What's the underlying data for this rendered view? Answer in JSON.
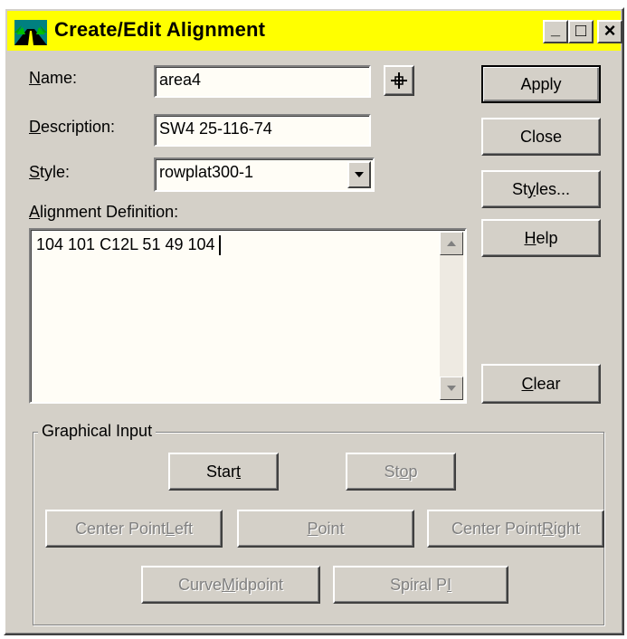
{
  "window": {
    "title": "Create/Edit Alignment",
    "title_bar_color": "#ffff00",
    "controls": {
      "minimize": "_",
      "maximize": "□",
      "close": "×"
    }
  },
  "form": {
    "name_label_key": "N",
    "name_label_rest": "ame:",
    "name_value": "area4",
    "description_label_key": "D",
    "description_label_rest": "escription:",
    "description_value": "SW4 25-116-74",
    "style_label_key": "S",
    "style_label_rest": "tyle:",
    "style_value": "rowplat300-1",
    "definition_label_key": "A",
    "definition_label_rest": "lignment Definition:",
    "definition_value": "104 101 C12L 51 49 104"
  },
  "buttons": {
    "apply": "Apply",
    "close": "Close",
    "styles_pre": "St",
    "styles_key": "y",
    "styles_post": "les...",
    "help_key": "H",
    "help_post": "elp",
    "clear_key": "C",
    "clear_post": "lear"
  },
  "graphical_input": {
    "group_label": "Graphical Input",
    "start_pre": "Star",
    "start_key": "t",
    "stop_pre": "St",
    "stop_key": "o",
    "stop_post": "p",
    "cpl_pre": "Center Point ",
    "cpl_key": "L",
    "cpl_post": "eft",
    "point_key": "P",
    "point_post": "oint",
    "cpr_pre": "Center Point ",
    "cpr_key": "R",
    "cpr_post": "ight",
    "curve_pre": "Curve ",
    "curve_key": "M",
    "curve_post": "idpoint",
    "spiral_pre": "Spiral P",
    "spiral_key": "I"
  },
  "icons": {
    "app": "road-alignment-icon",
    "pick": "crosshair-icon"
  }
}
